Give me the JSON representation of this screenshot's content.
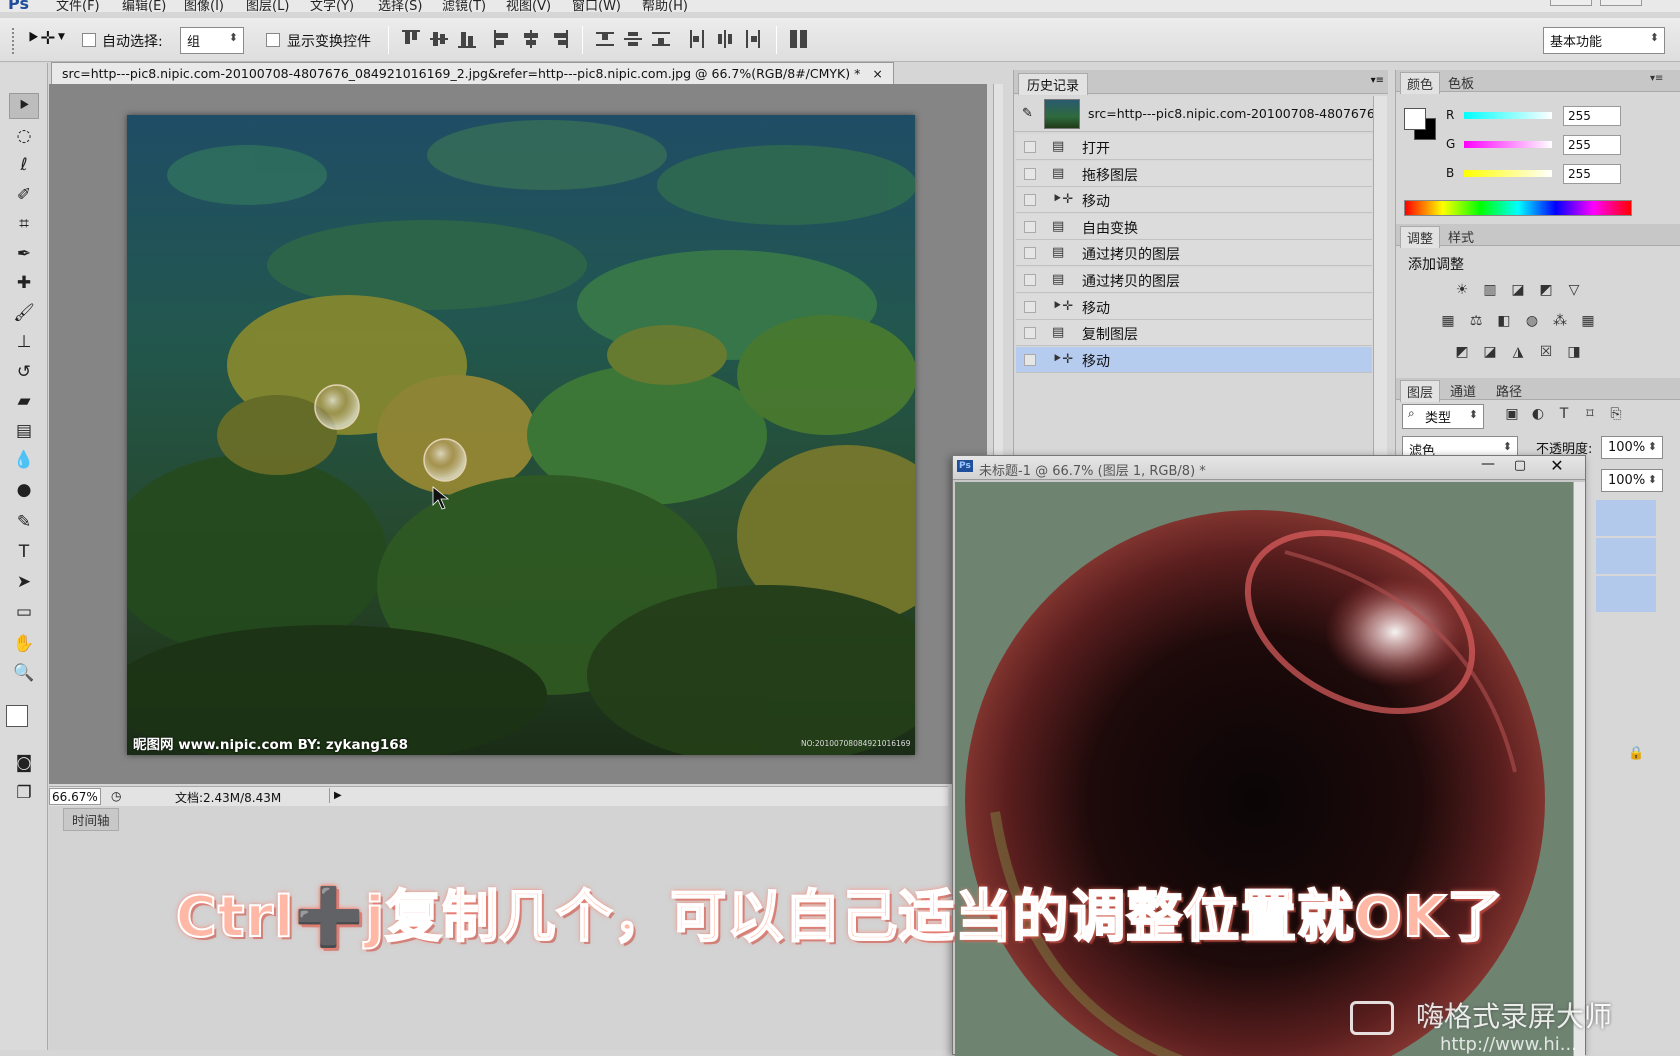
{
  "menubar": {
    "logo": "Ps",
    "items": [
      "文件(F)",
      "编辑(E)",
      "图像(I)",
      "图层(L)",
      "文字(Y)",
      "选择(S)",
      "滤镜(T)",
      "视图(V)",
      "窗口(W)",
      "帮助(H)"
    ]
  },
  "options": {
    "auto_select_label": "自动选择:",
    "auto_select_value": "组",
    "show_transform_label": "显示变换控件",
    "workspace_value": "基本功能"
  },
  "document": {
    "tab_title": "src=http---pic8.nipic.com-20100708-4807676_084921016169_2.jpg&refer=http---pic8.nipic.com.jpg @ 66.7%(RGB/8#/CMYK) *",
    "close_glyph": "×",
    "photo_watermark": "昵图网 www.nipic.com   BY: zykang168",
    "photo_id": "NO:20100708084921016169",
    "zoom": "66.67%",
    "doc_size": "文档:2.43M/8.43M"
  },
  "timeline": {
    "tab": "时间轴"
  },
  "history": {
    "tab": "历史记录",
    "snapshot_label": "src=http---pic8.nipic.com-20100708-4807676...",
    "items": [
      {
        "label": "打开",
        "icon": "doc-icon"
      },
      {
        "label": "拖移图层",
        "icon": "doc-icon"
      },
      {
        "label": "移动",
        "icon": "move-icon"
      },
      {
        "label": "自由变换",
        "icon": "doc-icon"
      },
      {
        "label": "通过拷贝的图层",
        "icon": "doc-icon"
      },
      {
        "label": "通过拷贝的图层",
        "icon": "doc-icon"
      },
      {
        "label": "移动",
        "icon": "move-icon"
      },
      {
        "label": "复制图层",
        "icon": "doc-icon"
      },
      {
        "label": "移动",
        "icon": "move-icon",
        "selected": true
      }
    ]
  },
  "color_panel": {
    "tabs": [
      "颜色",
      "色板"
    ],
    "r_label": "R",
    "r_value": "255",
    "g_label": "G",
    "g_value": "255",
    "b_label": "B",
    "b_value": "255"
  },
  "adjust_panel": {
    "tabs": [
      "调整",
      "样式"
    ],
    "heading": "添加调整"
  },
  "layers_panel": {
    "tabs": [
      "图层",
      "通道",
      "路径"
    ],
    "filter_value": "类型",
    "blend_value": "滤色",
    "opacity_label": "不透明度:",
    "opacity_value": "100%",
    "fill_value": "100%"
  },
  "float_window": {
    "title": "未标题-1 @ 66.7% (图层 1, RGB/8) *",
    "ps_badge": "Ps"
  },
  "caption": "Ctrl➕j复制几个，可以自己适当的调整位置就OK了",
  "recorder_watermark": "嗨格式录屏大师",
  "recorder_url": "http://www.hi..."
}
